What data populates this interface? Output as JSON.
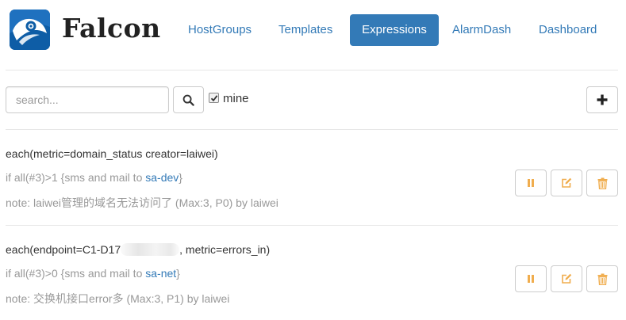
{
  "brand": {
    "name": "Falcon",
    "logo_icon": "falcon-eye-logo"
  },
  "nav": {
    "items": [
      {
        "label": "HostGroups",
        "active": false
      },
      {
        "label": "Templates",
        "active": false
      },
      {
        "label": "Expressions",
        "active": true
      },
      {
        "label": "AlarmDash",
        "active": false
      },
      {
        "label": "Dashboard",
        "active": false
      }
    ]
  },
  "toolbar": {
    "search_placeholder": "search...",
    "search_value": "",
    "search_icon": "search-icon",
    "mine_label": "mine",
    "mine_checked": true,
    "add_icon": "plus-icon"
  },
  "expressions": [
    {
      "title": "each(metric=domain_status creator=laiwei)",
      "cond_prefix": "if all(#3)>1 {sms and mail to ",
      "team": "sa-dev",
      "cond_suffix": "}",
      "note": "note: laiwei管理的域名无法访问了 (Max:3, P0) by laiwei"
    },
    {
      "title_prefix": "each(endpoint=C1-D17",
      "title_suffix": ", metric=errors_in)",
      "cond_prefix": "if all(#3)>0 {sms and mail to ",
      "team": "sa-net",
      "cond_suffix": "}",
      "note": "note: 交换机接口error多 (Max:3, P1) by laiwei"
    }
  ],
  "colors": {
    "primary": "#337ab7",
    "action_orange": "#f0ad4e",
    "muted": "#999999"
  },
  "row_actions": [
    "pause-icon",
    "edit-icon",
    "trash-icon"
  ]
}
